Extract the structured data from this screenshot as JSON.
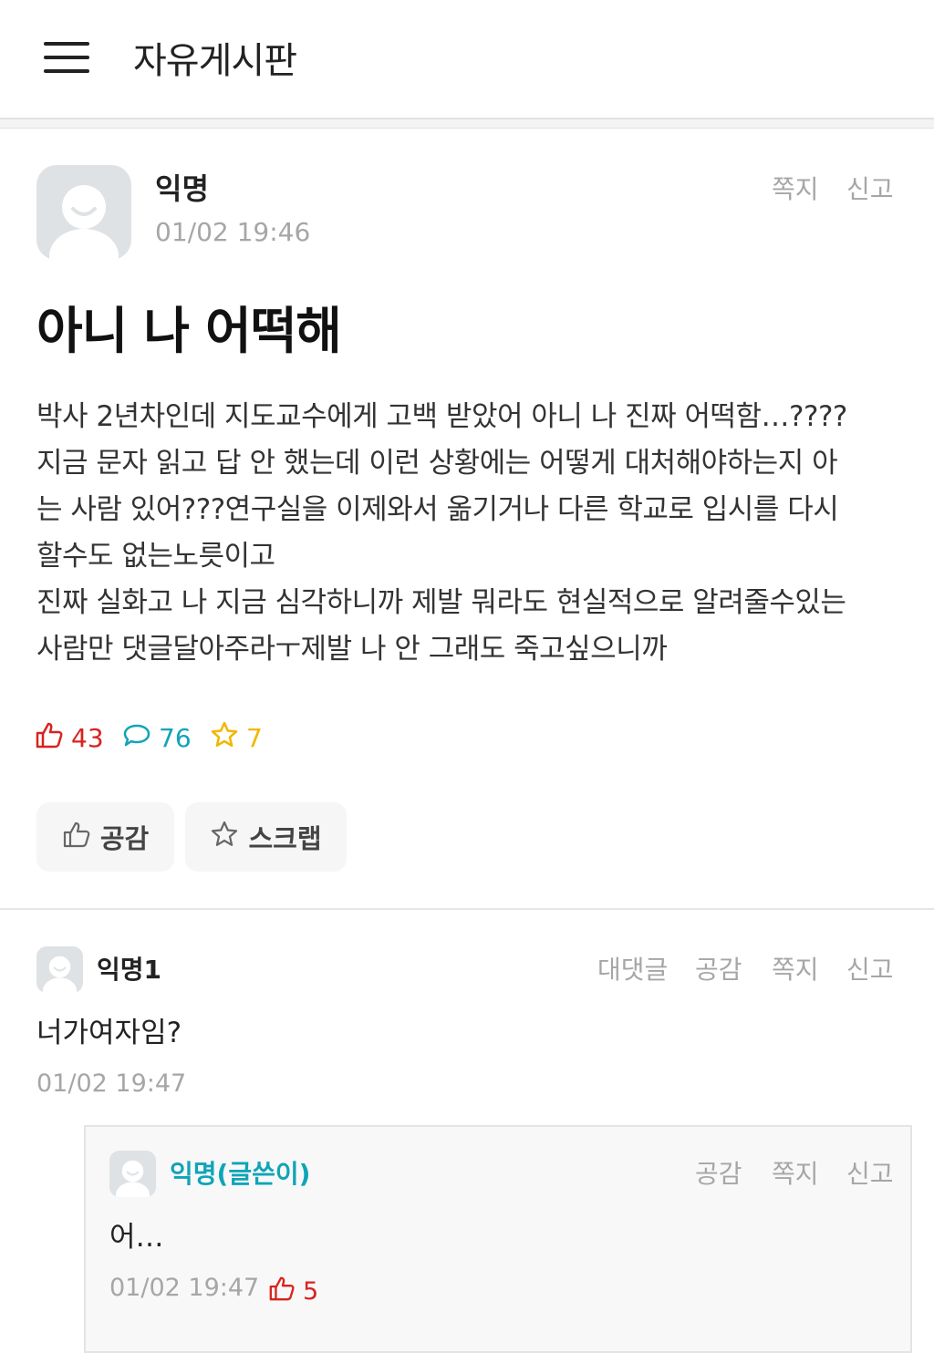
{
  "header": {
    "board_title": "자유게시판"
  },
  "post": {
    "author": "익명",
    "timestamp": "01/02 19:46",
    "actions": {
      "message": "쪽지",
      "report": "신고"
    },
    "title": "아니 나 어떡해",
    "body_lines": [
      "박사 2년차인데 지도교수에게 고백 받았어 아니 나 진짜 어떡함…????",
      "지금 문자 읽고 답 안 했는데 이런 상황에는 어떻게 대처해야하는지 아",
      "는 사람 있어???연구실을 이제와서 옮기거나 다른 학교로 입시를 다시",
      "할수도 없는노릇이고",
      "진짜 실화고 나 지금 심각하니까 제발 뭐라도 현실적으로 알려줄수있는",
      "사람만 댓글달아주라ㅜ제발 나 안 그래도 죽고싶으니까"
    ],
    "stats": {
      "likes": "43",
      "comments": "76",
      "scraps": "7"
    },
    "buttons": {
      "like": "공감",
      "scrap": "스크랩"
    }
  },
  "comments": [
    {
      "author": "익명1",
      "actions": {
        "reply": "대댓글",
        "like": "공감",
        "message": "쪽지",
        "report": "신고"
      },
      "text": "너가여자임?",
      "timestamp": "01/02 19:47",
      "replies": [
        {
          "author": "익명(글쓴이)",
          "actions": {
            "like": "공감",
            "message": "쪽지",
            "report": "신고"
          },
          "text": "어…",
          "timestamp": "01/02 19:47",
          "likes": "5"
        }
      ]
    }
  ],
  "colors": {
    "like_red": "#d8231f",
    "comment_teal": "#10a4b8",
    "scrap_yellow": "#f2b600",
    "muted_gray": "#a6a6a6",
    "avatar_gray": "#dfe2e4"
  },
  "icons": {
    "menu": "hamburger-menu-icon",
    "avatar": "default-avatar-icon",
    "like": "thumbs-up-icon",
    "comment": "speech-bubble-icon",
    "scrap": "star-icon"
  }
}
